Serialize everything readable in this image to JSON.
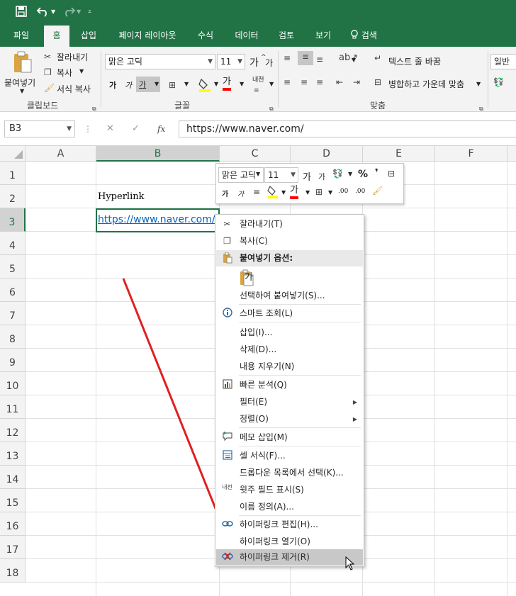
{
  "tabs": [
    "파일",
    "홈",
    "삽입",
    "페이지 레이아웃",
    "수식",
    "데이터",
    "검토",
    "보기",
    "검색"
  ],
  "clipboard": {
    "paste_label": "붙여넣기",
    "cut_label": "잘라내기",
    "copy_label": "복사",
    "format_painter_label": "서식 복사",
    "group_label": "클립보드"
  },
  "font": {
    "name": "맑은 고딕",
    "size": "11",
    "group_label": "글꼴",
    "grow_glyph": "가",
    "shrink_glyph": "가",
    "bold_glyph": "가",
    "italic_glyph": "가",
    "underline_glyph": "가",
    "color_glyph": "가",
    "phonetic_glyph": "내천"
  },
  "alignment": {
    "wrap_text_label": "텍스트 줄 바꿈",
    "merge_center_label": "병합하고 가운데 맞춤",
    "group_label": "맞춤"
  },
  "number": {
    "format": "일반"
  },
  "formula_bar": {
    "name_box": "B3",
    "cancel_glyph": "✕",
    "enter_glyph": "✓",
    "fx_label": "fx",
    "content": "https://www.naver.com/"
  },
  "columns": [
    "A",
    "B",
    "C",
    "D",
    "E",
    "F"
  ],
  "rows": [
    "1",
    "2",
    "3",
    "4",
    "5",
    "6",
    "7",
    "8",
    "9",
    "10",
    "11",
    "12",
    "13",
    "14",
    "15",
    "16",
    "17",
    "18"
  ],
  "cells": {
    "b2": "Hyperlink",
    "b3": "https://www.naver.com/"
  },
  "mini_toolbar": {
    "font_name": "맑은 고딕",
    "font_size": "11",
    "percent_glyph": "%",
    "comma_glyph": "❜",
    "bold_glyph": "가",
    "italic_glyph": "가",
    "color_glyph": "가",
    "increase_decimal": ".00",
    "decrease_decimal": ".00"
  },
  "context_menu": {
    "items": [
      "잘라내기(T)",
      "복사(C)",
      "붙여넣기 옵션:",
      "가",
      "선택하여 붙여넣기(S)...",
      "스마트 조회(L)",
      "삽입(I)...",
      "삭제(D)...",
      "내용 지우기(N)",
      "빠른 분석(Q)",
      "필터(E)",
      "정렬(O)",
      "메모 삽입(M)",
      "셀 서식(F)...",
      "드롭다운 목록에서 선택(K)...",
      "윗주 필드 표시(S)",
      "이름 정의(A)...",
      "하이퍼링크 편집(H)...",
      "하이퍼링크 열기(O)",
      "하이퍼링크 제거(R)"
    ],
    "phonetic_icon_text": "내천"
  },
  "colors": {
    "brand": "#217346",
    "arrow": "#e02020",
    "link": "#0563c1",
    "highlight_yellow": "#ffff00",
    "font_red": "#ff0000"
  }
}
